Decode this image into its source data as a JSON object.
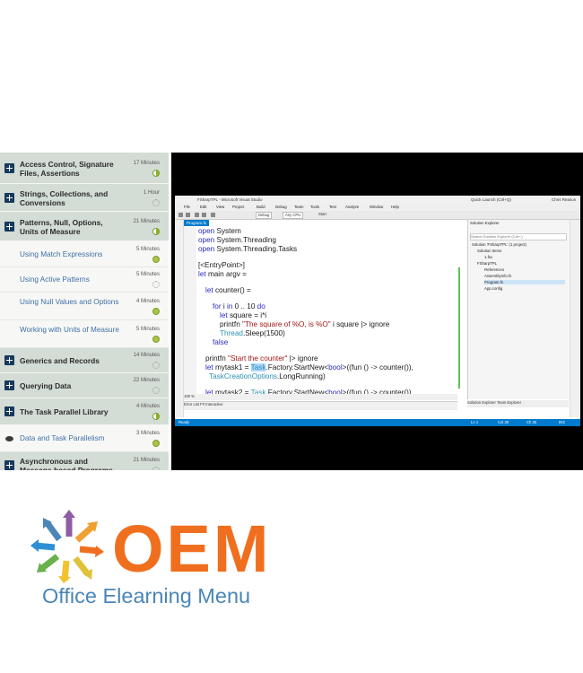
{
  "sidebar": {
    "items": [
      {
        "type": "section",
        "title": "Access Control, Signature Files, Assertions",
        "duration": "17 Minutes",
        "status": "half"
      },
      {
        "type": "section",
        "title": "Strings, Collections, and Conversions",
        "duration": "1 Hour",
        "status": "dotted"
      },
      {
        "type": "section",
        "title": "Patterns, Null, Options, Units of Measure",
        "duration": "21 Minutes",
        "status": "half"
      },
      {
        "type": "lesson",
        "title": "Using Match Expressions",
        "duration": "5 Minutes",
        "status": "full"
      },
      {
        "type": "lesson",
        "title": "Using Active Patterns",
        "duration": "5 Minutes",
        "status": "dotted"
      },
      {
        "type": "lesson",
        "title": "Using Null Values and Options",
        "duration": "4 Minutes",
        "status": "full"
      },
      {
        "type": "lesson",
        "title": "Working with Units of Measure",
        "duration": "5 Minutes",
        "status": "full"
      },
      {
        "type": "section",
        "title": "Generics and Records",
        "duration": "14 Minutes",
        "status": "dotted"
      },
      {
        "type": "section",
        "title": "Querying Data",
        "duration": "22 Minutes",
        "status": "dotted"
      },
      {
        "type": "section",
        "title": "The Task Parallel Library",
        "duration": "4 Minutes",
        "status": "half"
      },
      {
        "type": "lesson-current",
        "title": "Data and Task Parallelism",
        "duration": "3 Minutes",
        "status": "full"
      },
      {
        "type": "section",
        "title": "Asynchronous and Message-based Programs",
        "duration": "21 Minutes",
        "status": "dotted"
      }
    ]
  },
  "vs": {
    "title": "FSharpTPL - Microsoft Visual Studio",
    "quick_launch": "Quick Launch (Ctrl+Q)",
    "user": "Chris Reason",
    "menu": [
      "File",
      "Edit",
      "View",
      "Project",
      "Build",
      "Debug",
      "Team",
      "Tools",
      "Test",
      "Analyze",
      "Window",
      "Help"
    ],
    "config": "Debug",
    "platform": "Any CPU",
    "start": "Start",
    "tab": "Program.fs",
    "zoom": "100 %",
    "error_tabs": "Error List   F# Interactive",
    "status": {
      "left": "Ready",
      "ln": "Ln 1",
      "col": "Col 35",
      "ch": "Ch 35",
      "ins": "INS"
    },
    "code": {
      "l1": [
        "open",
        "System"
      ],
      "l2": [
        "open",
        "System.Threading"
      ],
      "l3": [
        "open",
        "System.Threading.Tasks"
      ],
      "l4": "[<EntryPoint>]",
      "l4_kw": "EntryPoint",
      "l5": [
        "let",
        "main argv ="
      ],
      "l6": [
        "let",
        "counter() ="
      ],
      "l7": [
        "for",
        "i",
        "in",
        "0 .. 10",
        "do"
      ],
      "l8": [
        "let",
        "square = i*i"
      ],
      "l9": [
        "printfn",
        "\"The square of %O, is %O\"",
        "i square |> ignore"
      ],
      "l10": [
        "Thread",
        ".Sleep(1500)"
      ],
      "l11": "false",
      "l12": [
        "printfn",
        "\"Start the counter\"",
        "|> ignore"
      ],
      "l13": [
        "let",
        "mytask1 =",
        "Task",
        ".Factory.StartNew<",
        "bool",
        ">((fun () -> counter()),"
      ],
      "l14": [
        "TaskCreationOptions",
        ".LongRunning)"
      ],
      "l15": [
        "let",
        "mytask2 =",
        "Task",
        ".Factory.StartNew<",
        "bool",
        ">((fun () -> counter())"
      ]
    },
    "solution_explorer": {
      "header": "Solution Explorer",
      "search": "Search Solution Explorer (Ctrl+;)",
      "nodes": [
        "Solution 'FSharpTPL' (1 project)",
        "Solution Items",
        "1.fsx",
        "FSharpTPL",
        "References",
        "AssemblyInfo.fs",
        "Program.fs",
        "App.config"
      ],
      "tabs": "Solution Explorer   Team Explorer"
    },
    "left_strip": "Server Explorer   Toolbox",
    "right_strip": "Properties"
  },
  "logo": {
    "text": "OEM",
    "subtitle": "Office Elearning Menu",
    "colors": {
      "orange": "#ef6f1f",
      "blue": "#4a86b8",
      "green": "#6ab04c",
      "yellow": "#f2c12e",
      "purple": "#8e5ea2",
      "teal": "#2f8fd6"
    }
  }
}
